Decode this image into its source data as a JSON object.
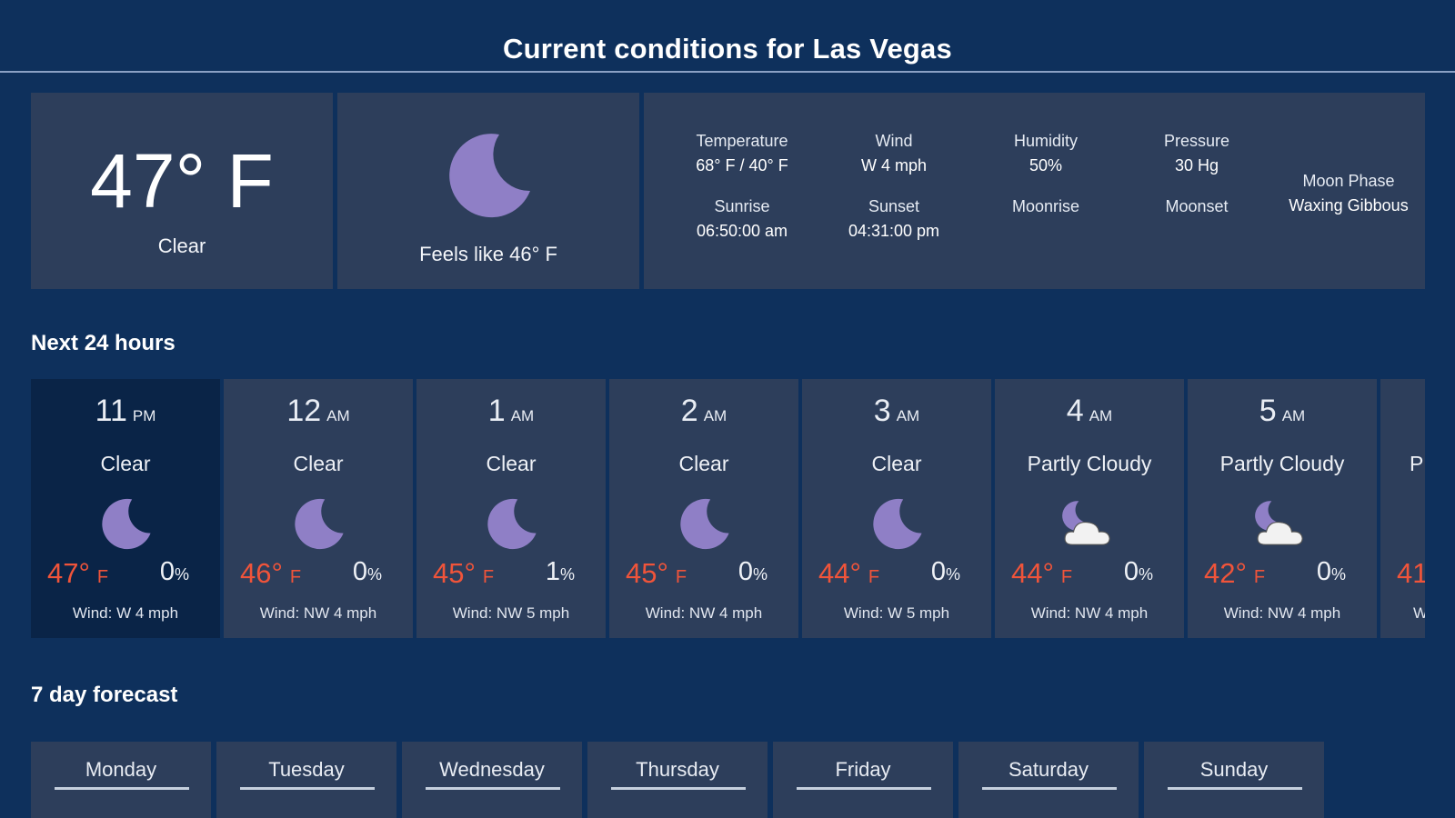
{
  "header": {
    "title": "Current conditions for Las Vegas"
  },
  "current": {
    "temperature": "47° F",
    "condition": "Clear",
    "icon": "moon-icon",
    "feels_like": "Feels like 46° F",
    "details": {
      "temperature_label": "Temperature",
      "temperature_value": "68° F / 40° F",
      "wind_label": "Wind",
      "wind_value": "W 4 mph",
      "humidity_label": "Humidity",
      "humidity_value": "50%",
      "pressure_label": "Pressure",
      "pressure_value": "30 Hg",
      "sunrise_label": "Sunrise",
      "sunrise_value": "06:50:00 am",
      "sunset_label": "Sunset",
      "sunset_value": "04:31:00 pm",
      "moonrise_label": "Moonrise",
      "moonset_label": "Moonset",
      "moon_phase_label": "Moon Phase",
      "moon_phase_value": "Waxing Gibbous"
    }
  },
  "hourly_title": "Next 24 hours",
  "hourly": [
    {
      "hour": "11",
      "ampm": "PM",
      "condition": "Clear",
      "icon": "moon-icon",
      "temp": "47°",
      "unit": "F",
      "precip": "0",
      "pct": "%",
      "wind": "Wind: W 4 mph"
    },
    {
      "hour": "12",
      "ampm": "AM",
      "condition": "Clear",
      "icon": "moon-icon",
      "temp": "46°",
      "unit": "F",
      "precip": "0",
      "pct": "%",
      "wind": "Wind: NW 4 mph"
    },
    {
      "hour": "1",
      "ampm": "AM",
      "condition": "Clear",
      "icon": "moon-icon",
      "temp": "45°",
      "unit": "F",
      "precip": "1",
      "pct": "%",
      "wind": "Wind: NW 5 mph"
    },
    {
      "hour": "2",
      "ampm": "AM",
      "condition": "Clear",
      "icon": "moon-icon",
      "temp": "45°",
      "unit": "F",
      "precip": "0",
      "pct": "%",
      "wind": "Wind: NW 4 mph"
    },
    {
      "hour": "3",
      "ampm": "AM",
      "condition": "Clear",
      "icon": "moon-icon",
      "temp": "44°",
      "unit": "F",
      "precip": "0",
      "pct": "%",
      "wind": "Wind: W 5 mph"
    },
    {
      "hour": "4",
      "ampm": "AM",
      "condition": "Partly Cloudy",
      "icon": "moon-cloud-icon",
      "temp": "44°",
      "unit": "F",
      "precip": "0",
      "pct": "%",
      "wind": "Wind: NW 4 mph"
    },
    {
      "hour": "5",
      "ampm": "AM",
      "condition": "Partly Cloudy",
      "icon": "moon-cloud-icon",
      "temp": "42°",
      "unit": "F",
      "precip": "0",
      "pct": "%",
      "wind": "Wind: NW 4 mph"
    },
    {
      "condition": "P",
      "temp": "41",
      "wind": "W"
    }
  ],
  "daily_title": "7 day forecast",
  "daily": [
    "Monday",
    "Tuesday",
    "Wednesday",
    "Thursday",
    "Friday",
    "Saturday",
    "Sunday"
  ],
  "colors": {
    "background": "#0e305c",
    "card": "#2d3e5b",
    "card_selected": "#0a2447",
    "temp": "#f0543a",
    "moon": "#8f7fc6"
  }
}
